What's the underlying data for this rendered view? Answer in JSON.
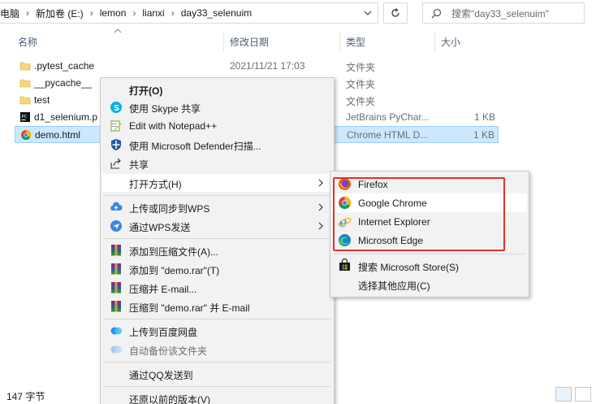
{
  "address": {
    "crumbs": [
      "此电脑",
      "新加卷 (E:)",
      "lemon",
      "lianxi",
      "day33_selenuim"
    ],
    "crumb_visible_0": "电脑"
  },
  "search": {
    "placeholder": "搜索\"day33_selenuim\""
  },
  "columns": {
    "name": "名称",
    "date": "修改日期",
    "type": "类型",
    "size": "大小"
  },
  "files": [
    {
      "name": ".pytest_cache",
      "date": "2021/11/21 17:03",
      "type": "文件夹",
      "size": "",
      "icon": "folder-icon"
    },
    {
      "name": "__pycache__",
      "date": "",
      "type": "文件夹",
      "size": "",
      "icon": "folder-icon"
    },
    {
      "name": "test",
      "date": "",
      "type": "文件夹",
      "size": "",
      "icon": "folder-icon"
    },
    {
      "name": "d1_selenium.p",
      "date": "",
      "type": "JetBrains PyChar...",
      "size": "1 KB",
      "icon": "pycharm-file-icon"
    },
    {
      "name": "demo.html",
      "date": "",
      "type": "Chrome HTML D...",
      "size": "1 KB",
      "icon": "chrome-file-icon"
    }
  ],
  "status": {
    "count": "147 字节"
  },
  "context_menu": {
    "items": [
      {
        "label": "打开(O)",
        "icon": "",
        "bold": true
      },
      {
        "label": "使用 Skype 共享",
        "icon": "skype-icon"
      },
      {
        "label": "Edit with Notepad++",
        "icon": "notepadpp-icon"
      },
      {
        "label": "使用 Microsoft Defender扫描...",
        "icon": "defender-shield-icon"
      },
      {
        "label": "共享",
        "icon": "share-icon"
      },
      {
        "label": "打开方式(H)",
        "icon": "",
        "submenu": true
      },
      {
        "label": "上传或同步到WPS",
        "icon": "wps-cloud-icon",
        "submenu": true
      },
      {
        "label": "通过WPS发送",
        "icon": "wps-send-icon",
        "submenu": true
      },
      {
        "label": "添加到压缩文件(A)...",
        "icon": "winrar-icon"
      },
      {
        "label": "添加到 \"demo.rar\"(T)",
        "icon": "winrar-icon"
      },
      {
        "label": "压缩并 E-mail...",
        "icon": "winrar-icon"
      },
      {
        "label": "压缩到 \"demo.rar\" 并 E-mail",
        "icon": "winrar-icon"
      },
      {
        "label": "上传到百度网盘",
        "icon": "baidu-netdisk-icon"
      },
      {
        "label": "自动备份该文件夹",
        "icon": "baidu-netdisk-icon",
        "disabled": true
      },
      {
        "label": "通过QQ发送到",
        "icon": ""
      },
      {
        "label": "还原以前的版本(V)",
        "icon": ""
      }
    ]
  },
  "open_with_menu": {
    "items": [
      {
        "label": "Firefox",
        "icon": "firefox-icon"
      },
      {
        "label": "Google Chrome",
        "icon": "chrome-icon"
      },
      {
        "label": "Internet Explorer",
        "icon": "ie-icon"
      },
      {
        "label": "Microsoft Edge",
        "icon": "edge-icon"
      },
      {
        "label": "搜索 Microsoft Store(S)",
        "icon": "store-icon"
      },
      {
        "label": "选择其他应用(C)",
        "icon": ""
      }
    ]
  },
  "colors": {
    "selection": "#cce8ff",
    "highlight_box": "#e8302a",
    "menu_bg": "#f2f2f2"
  }
}
